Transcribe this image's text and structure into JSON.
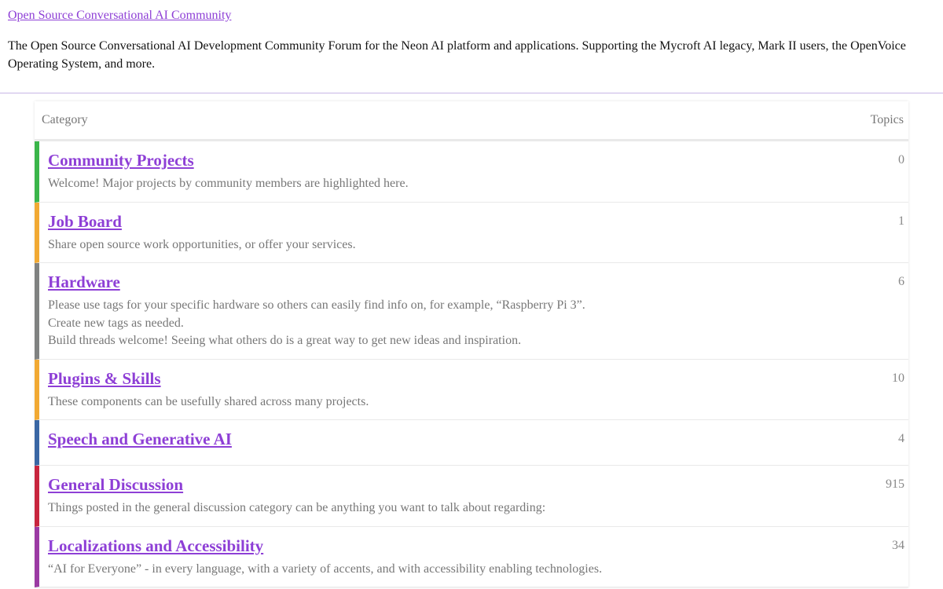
{
  "header": {
    "site_link": "Open Source Conversational AI Community",
    "intro": "The Open Source Conversational AI Development Community Forum for the Neon AI platform and applications. Supporting the Mycroft AI legacy, Mark II users, the OpenVoice Operating System, and more."
  },
  "table": {
    "col_category": "Category",
    "col_topics": "Topics",
    "rows": [
      {
        "name": "Community Projects",
        "color": "#3ab54a",
        "topics": "0",
        "desc": [
          "Welcome! Major projects by community members are highlighted here."
        ]
      },
      {
        "name": "Job Board",
        "color": "#f1a933",
        "topics": "1",
        "desc": [
          "Share open source work opportunities, or offer your services."
        ]
      },
      {
        "name": "Hardware",
        "color": "#808281",
        "topics": "6",
        "desc": [
          "Please use tags for your specific hardware so others can easily find info on, for example, “Raspberry Pi 3”.",
          "Create new tags as needed.",
          "Build threads welcome! Seeing what others do is a great way to get new ideas and inspiration."
        ]
      },
      {
        "name": "Plugins & Skills",
        "color": "#f1a933",
        "topics": "10",
        "desc": [
          "These components can be usefully shared across many projects."
        ]
      },
      {
        "name": "Speech and Generative AI",
        "color": "#3a67a4",
        "topics": "4",
        "desc": []
      },
      {
        "name": "General Discussion",
        "color": "#c8253e",
        "topics": "915",
        "desc": [
          "Things posted in the general discussion category can be anything you want to talk about regarding:"
        ]
      },
      {
        "name": "Localizations and Accessibility",
        "color": "#9b3aa3",
        "topics": "34",
        "desc": [
          "“AI for Everyone” - in every language, with a variety of accents, and with accessibility enabling technologies."
        ]
      }
    ]
  }
}
